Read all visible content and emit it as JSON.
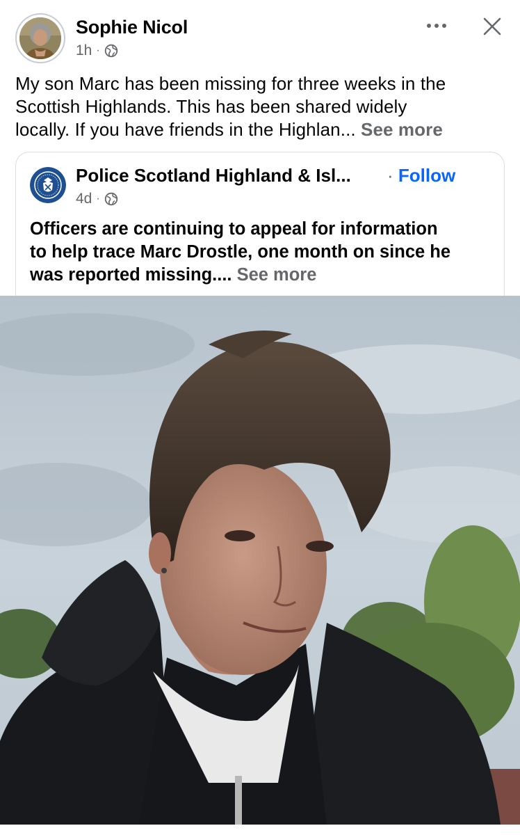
{
  "author": {
    "name": "Sophie Nicol",
    "time": "1h",
    "separator": "·",
    "audience_icon": "globe-icon"
  },
  "header_actions": {
    "more_icon": "more-options-icon",
    "close_icon": "close-icon"
  },
  "post": {
    "lines": [
      "My son Marc has been missing for three weeks in the",
      "Scottish Highlands. This has been shared widely",
      "locally. If you have friends in the Highlan..."
    ],
    "see_more": "See more"
  },
  "shared_post": {
    "page_name": "Police Scotland Highland & Isl...",
    "separator": "·",
    "follow_label": "Follow",
    "time": "4d",
    "audience_icon": "globe-icon",
    "lines": [
      "Officers are continuing to appeal for information",
      "to help trace Marc Drostle, one month on since he",
      "was reported missing...."
    ],
    "see_more": "See more"
  },
  "colors": {
    "text": "#050505",
    "secondary_text": "#65676b",
    "link_blue": "#0866ff",
    "police_blue": "#1d4f91"
  }
}
